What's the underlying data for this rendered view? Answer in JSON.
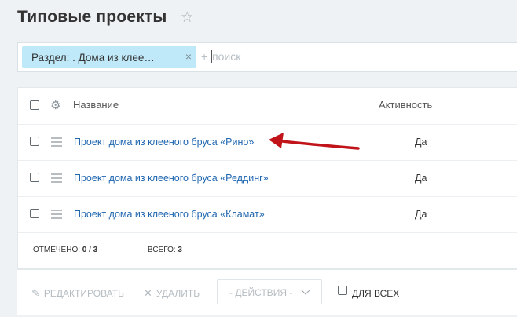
{
  "header": {
    "title": "Типовые проекты",
    "favorite_icon": "star-icon"
  },
  "filter": {
    "chip_label": "Раздел: . Дома из клее…",
    "chip_close": "×",
    "search_plus": "+",
    "search_placeholder": "поиск"
  },
  "grid": {
    "columns": {
      "name": "Название",
      "active": "Активность"
    },
    "rows": [
      {
        "name": "Проект дома из клееного бруса «Рино»",
        "active": "Да"
      },
      {
        "name": "Проект дома из клееного бруса «Реддинг»",
        "active": "Да"
      },
      {
        "name": "Проект дома из клееного бруса «Кламат»",
        "active": "Да"
      }
    ],
    "footer": {
      "selected_label": "ОТМЕЧЕНО:",
      "selected_value": "0 / 3",
      "total_label": "ВСЕГО:",
      "total_value": "3"
    }
  },
  "toolbar": {
    "edit_label": "РЕДАКТИРОВАТЬ",
    "delete_label": "УДАЛИТЬ",
    "actions_label": "- ДЕЙСТВИЯ -",
    "for_all_label": "ДЛЯ ВСЕХ"
  },
  "colors": {
    "link": "#2067b0",
    "chip_bg": "#bfe9f8",
    "annotation_arrow": "#c0141a"
  }
}
